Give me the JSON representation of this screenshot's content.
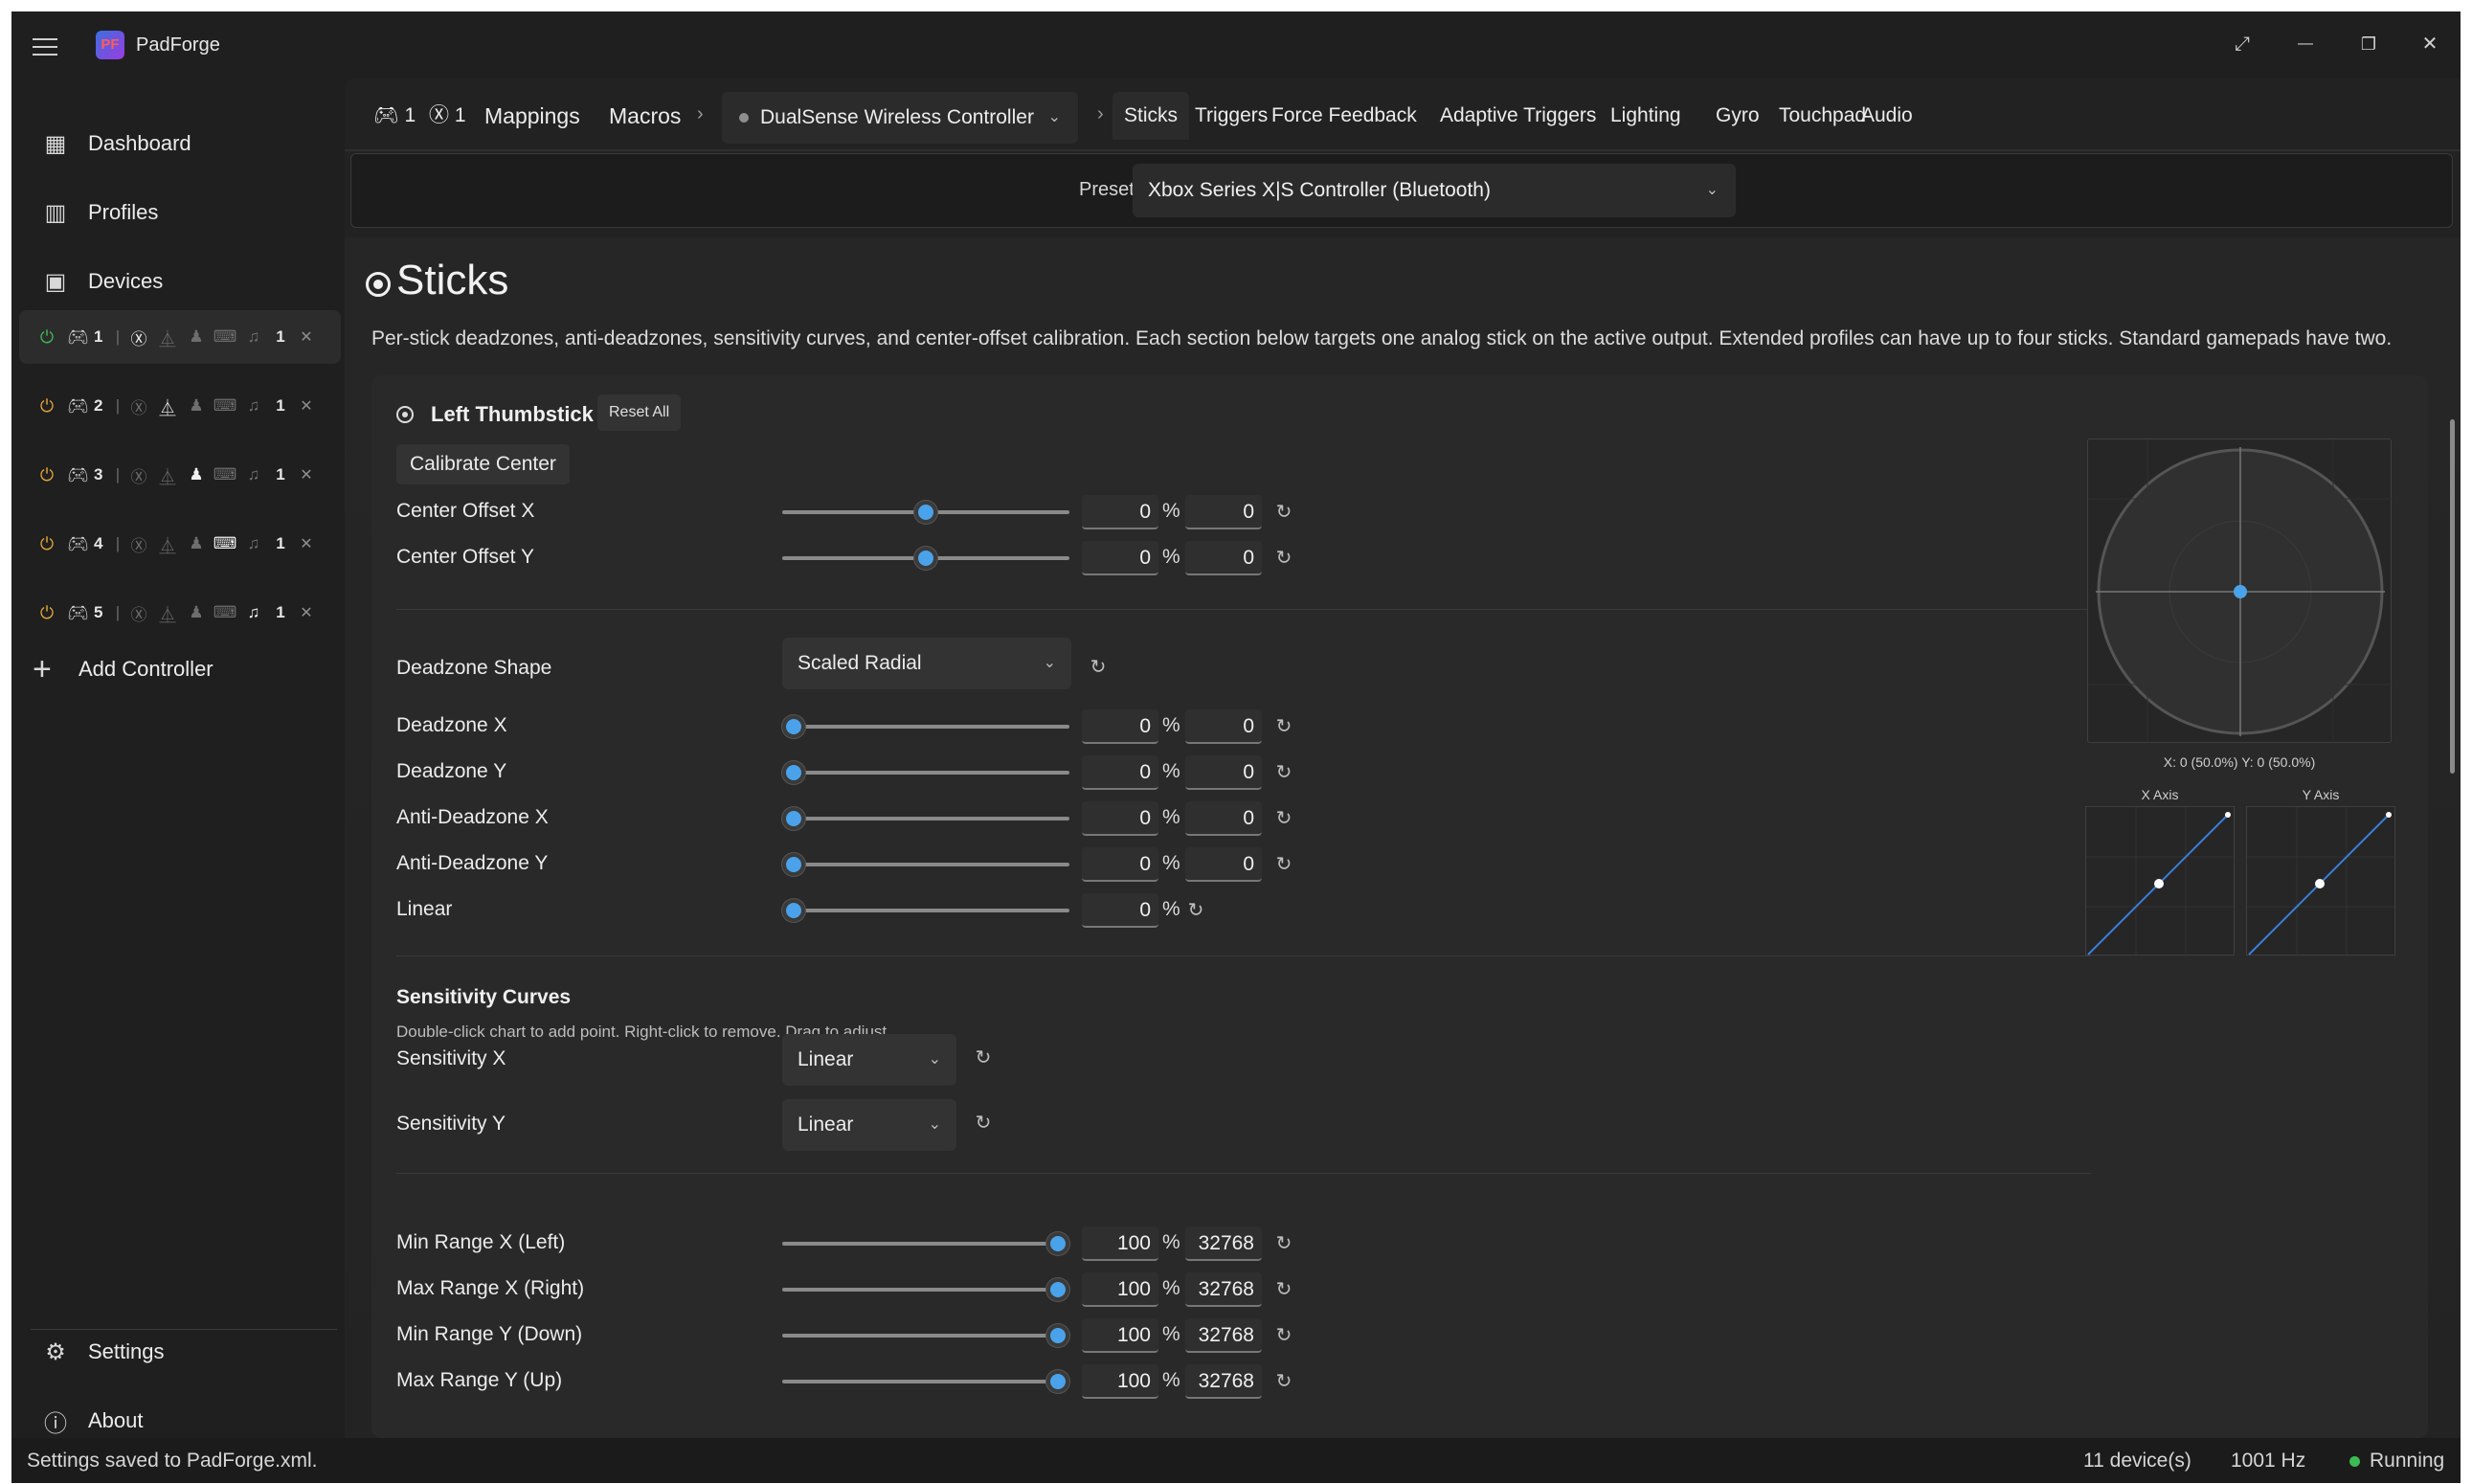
{
  "app": {
    "title": "PadForge",
    "logo_text": "PF"
  },
  "window_controls": {
    "fullscreen": "⤢",
    "minimize": "—",
    "restore": "❐",
    "close": "✕"
  },
  "sidebar": {
    "nav": [
      {
        "label": "Dashboard",
        "icon": "dashboard-icon"
      },
      {
        "label": "Profiles",
        "icon": "library-icon"
      },
      {
        "label": "Devices",
        "icon": "devices-icon"
      }
    ],
    "slots": [
      {
        "num": "1",
        "count": "1",
        "active": true,
        "power_on": true,
        "lit": "xbox"
      },
      {
        "num": "2",
        "count": "1",
        "active": false,
        "power_on": false,
        "lit": "playstation"
      },
      {
        "num": "3",
        "count": "1",
        "active": false,
        "power_on": false,
        "lit": "person"
      },
      {
        "num": "4",
        "count": "1",
        "active": false,
        "power_on": false,
        "lit": "keyboard"
      },
      {
        "num": "5",
        "count": "1",
        "active": false,
        "power_on": false,
        "lit": "midi"
      }
    ],
    "add_controller": "Add Controller",
    "settings": "Settings",
    "about": "About"
  },
  "tabbar": {
    "counts": {
      "pads": "1",
      "xbox": "1"
    },
    "mappings": "Mappings",
    "macros": "Macros",
    "device": "DualSense Wireless Controller",
    "tabs": [
      "Sticks",
      "Triggers",
      "Force Feedback",
      "Adaptive Triggers",
      "Lighting",
      "Gyro",
      "Touchpad",
      "Audio"
    ],
    "selected": "Sticks"
  },
  "preset": {
    "label": "Preset",
    "value": "Xbox Series X|S Controller (Bluetooth)"
  },
  "section": {
    "title": "Sticks",
    "description": "Per-stick deadzones, anti-deadzones, sensitivity curves, and center-offset calibration. Each section below targets one analog stick on the active output. Extended profiles can have up to four sticks. Standard gamepads have two."
  },
  "stick": {
    "title": "Left Thumbstick",
    "reset_all": "Reset All",
    "calibrate": "Calibrate Center",
    "offsets": [
      {
        "label": "Center Offset X",
        "pct": "0",
        "raw": "0",
        "level": 0.5
      },
      {
        "label": "Center Offset Y",
        "pct": "0",
        "raw": "0",
        "level": 0.5
      }
    ],
    "deadzone_shape": {
      "label": "Deadzone Shape",
      "value": "Scaled Radial"
    },
    "deadzones": [
      {
        "label": "Deadzone X",
        "pct": "0",
        "raw": "0",
        "level": 0
      },
      {
        "label": "Deadzone Y",
        "pct": "0",
        "raw": "0",
        "level": 0
      },
      {
        "label": "Anti-Deadzone X",
        "pct": "0",
        "raw": "0",
        "level": 0
      },
      {
        "label": "Anti-Deadzone Y",
        "pct": "0",
        "raw": "0",
        "level": 0
      }
    ],
    "linear": {
      "label": "Linear",
      "pct": "0",
      "level": 0
    },
    "sensitivity": {
      "title": "Sensitivity Curves",
      "note": "Double-click chart to add point. Right-click to remove. Drag to adjust.",
      "x": {
        "label": "Sensitivity X",
        "value": "Linear"
      },
      "y": {
        "label": "Sensitivity Y",
        "value": "Linear"
      }
    },
    "ranges": [
      {
        "label": "Min Range X (Left)",
        "pct": "100",
        "raw": "32768",
        "level": 1
      },
      {
        "label": "Max Range X (Right)",
        "pct": "100",
        "raw": "32768",
        "level": 1
      },
      {
        "label": "Min Range Y (Down)",
        "pct": "100",
        "raw": "32768",
        "level": 1
      },
      {
        "label": "Max Range Y (Up)",
        "pct": "100",
        "raw": "32768",
        "level": 1
      }
    ],
    "preview": {
      "coords": "X: 0 (50.0%)  Y: 0 (50.0%)",
      "x_axis": "X Axis",
      "y_axis": "Y Axis"
    }
  },
  "percent_sign": "%",
  "status": {
    "message": "Settings saved to PadForge.xml.",
    "devices": "11 device(s)",
    "rate": "1001 Hz",
    "state": "Running"
  },
  "colors": {
    "accent": "#4aa3ea",
    "running": "#3cba54",
    "power_idle": "#e0a43a"
  }
}
